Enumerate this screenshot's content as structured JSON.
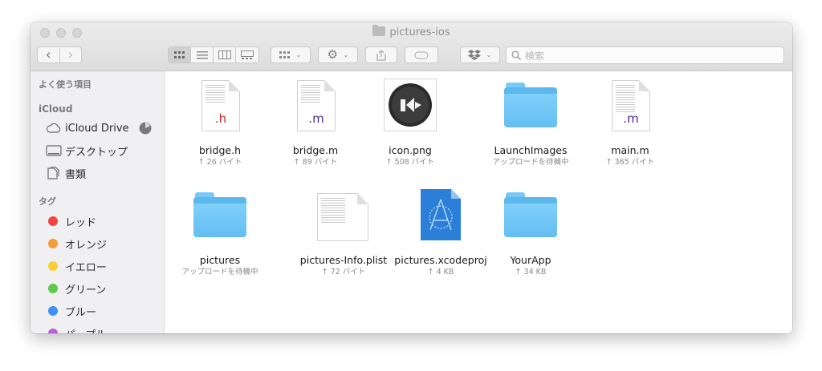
{
  "window": {
    "title": "pictures-ios"
  },
  "toolbar": {
    "back": "‹",
    "forward": "›",
    "views": [
      "icon-view",
      "list-view",
      "column-view",
      "gallery-view"
    ],
    "group_icon": "group-icon",
    "action_icon": "gear-icon",
    "share_icon": "share-icon",
    "tag_icon": "tag-icon",
    "dropbox_icon": "dropbox-icon",
    "search_placeholder": "検索"
  },
  "sidebar": {
    "favorites_header": "よく使う項目",
    "icloud_header": "iCloud",
    "icloud_items": [
      {
        "label": "iCloud Drive",
        "icon": "cloud-icon"
      },
      {
        "label": "デスクトップ",
        "icon": "desktop-icon"
      },
      {
        "label": "書類",
        "icon": "documents-icon"
      }
    ],
    "tags_header": "タグ",
    "tags": [
      {
        "label": "レッド",
        "color": "#f2453e"
      },
      {
        "label": "オレンジ",
        "color": "#f59b34"
      },
      {
        "label": "イエロー",
        "color": "#f8cf3a"
      },
      {
        "label": "グリーン",
        "color": "#5cc94a"
      },
      {
        "label": "ブルー",
        "color": "#3f8ff6"
      },
      {
        "label": "パープル",
        "color": "#b55ed6"
      }
    ]
  },
  "files": [
    {
      "name": "bridge.h",
      "meta": "↑ 26 バイト",
      "kind": "doc",
      "ext": ".h",
      "ext_color": "#c8262a"
    },
    {
      "name": "bridge.m",
      "meta": "↑ 89 バイト",
      "kind": "doc",
      "ext": ".m",
      "ext_color": "#4a2a9c"
    },
    {
      "name": "icon.png",
      "meta": "↑ 508 バイト",
      "kind": "image"
    },
    {
      "name": "LaunchImages",
      "meta": "アップロードを待機中",
      "kind": "folder"
    },
    {
      "name": "main.m",
      "meta": "↑ 365 バイト",
      "kind": "doc",
      "ext": ".m",
      "ext_color": "#4a2a9c"
    },
    {
      "name": "pictures",
      "meta": "アップロードを待機中",
      "kind": "folder"
    },
    {
      "name": "pictures-Info.plist",
      "meta": "↑ 72 バイト",
      "kind": "doc",
      "ext": ""
    },
    {
      "name": "pictures.xcodeproj",
      "meta": "↑ 4 KB",
      "kind": "xcode"
    },
    {
      "name": "YourApp",
      "meta": "↑ 34 KB",
      "kind": "folder"
    }
  ]
}
